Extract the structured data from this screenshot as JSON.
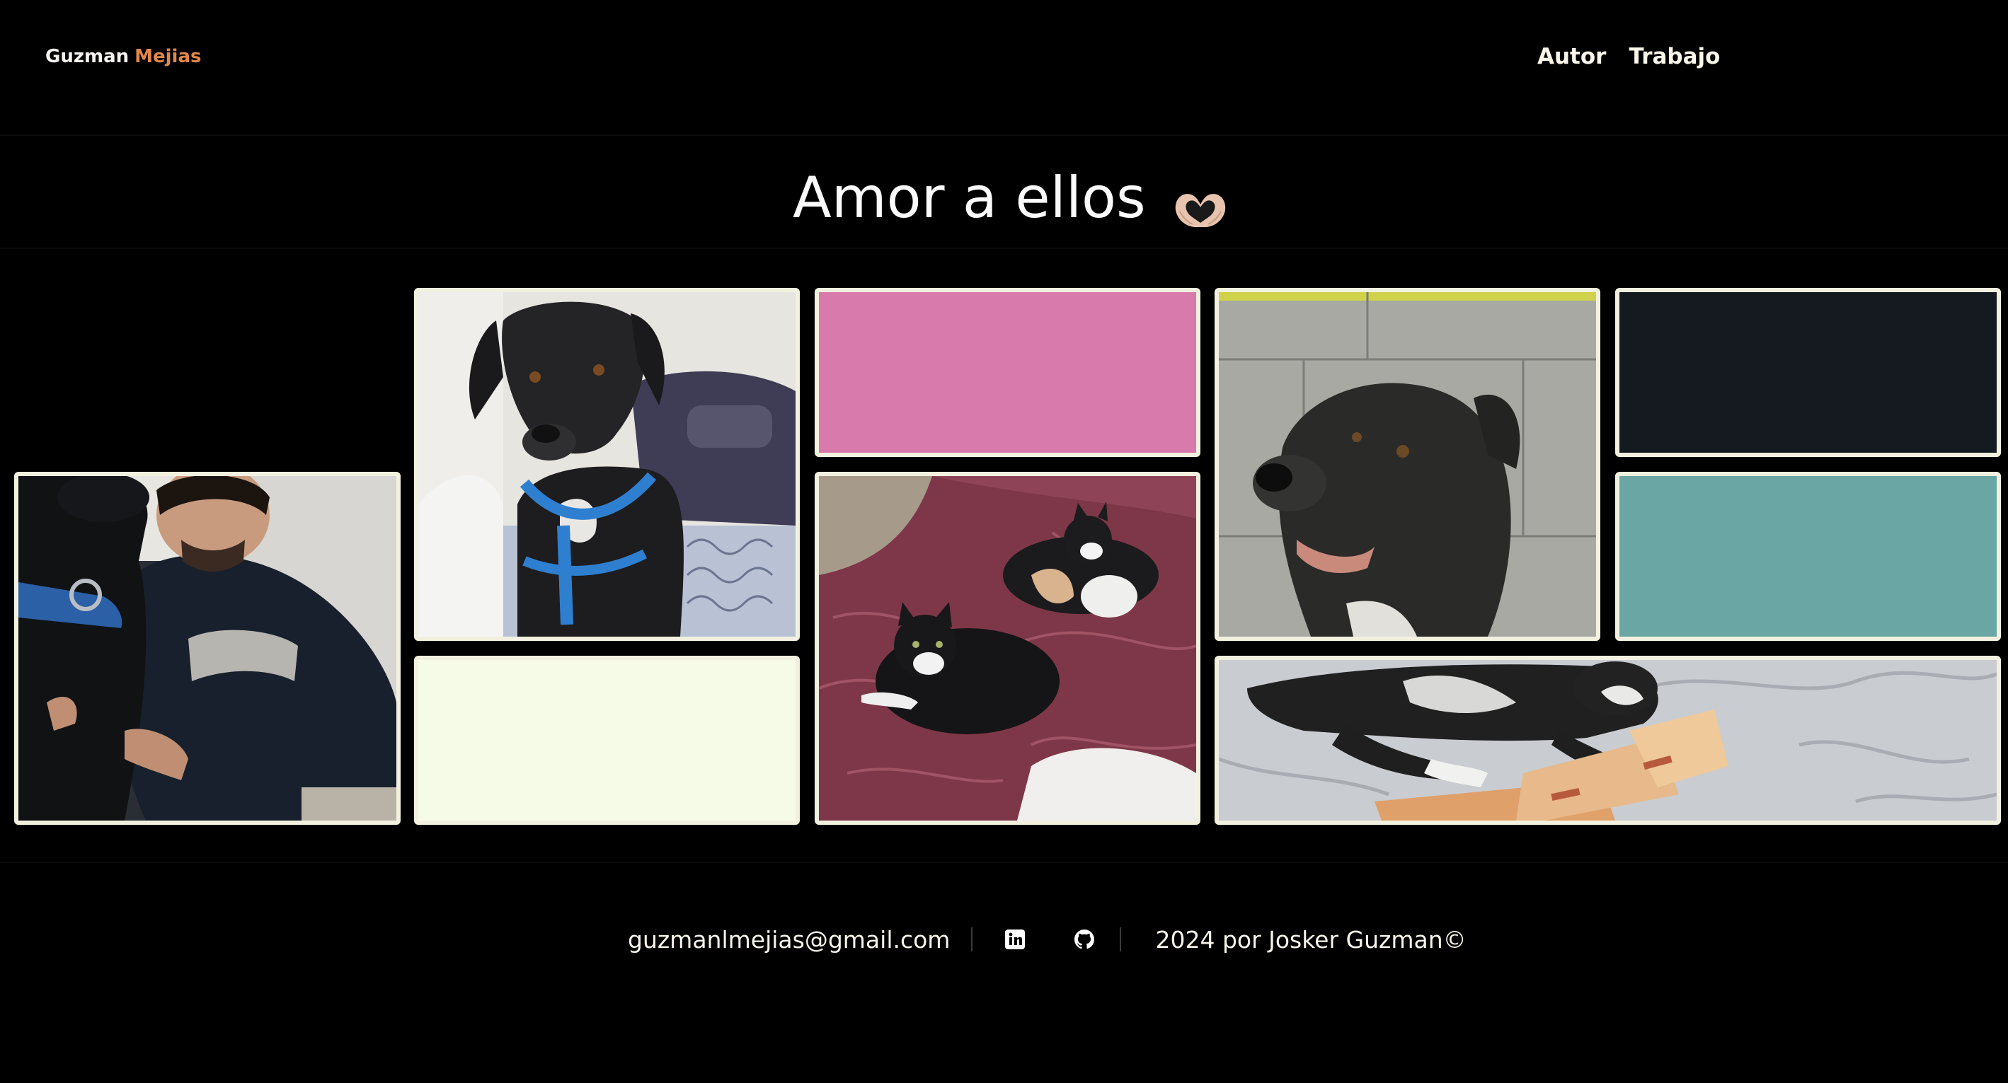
{
  "header": {
    "brand_first": "Guzman",
    "brand_last": "Mejias",
    "nav": [
      {
        "label": "Autor"
      },
      {
        "label": "Trabajo"
      }
    ]
  },
  "main": {
    "title": "Amor a ellos",
    "title_emoji_icon": "heart-hands-icon"
  },
  "gallery": {
    "tiles": [
      {
        "kind": "photo",
        "subject": "person-hugging-dog"
      },
      {
        "kind": "photo",
        "subject": "dog-blue-harness"
      },
      {
        "kind": "color",
        "color": "#d97aac"
      },
      {
        "kind": "photo",
        "subject": "dog-closeup"
      },
      {
        "kind": "color",
        "color": "#151a21"
      },
      {
        "kind": "color",
        "color": "#f5fbe7"
      },
      {
        "kind": "photo",
        "subject": "two-kittens-on-bed"
      },
      {
        "kind": "color",
        "color": "#6aa6a4"
      },
      {
        "kind": "photo",
        "subject": "cat-with-banknotes"
      }
    ]
  },
  "footer": {
    "email": "guzmanlmejias@gmail.com",
    "linkedin_icon": "linkedin-icon",
    "github_icon": "github-icon",
    "copyright": "2024 por Josker Guzman©"
  },
  "colors": {
    "background": "#000000",
    "accent": "#e0884c",
    "tile_border": "#f2f1df"
  }
}
